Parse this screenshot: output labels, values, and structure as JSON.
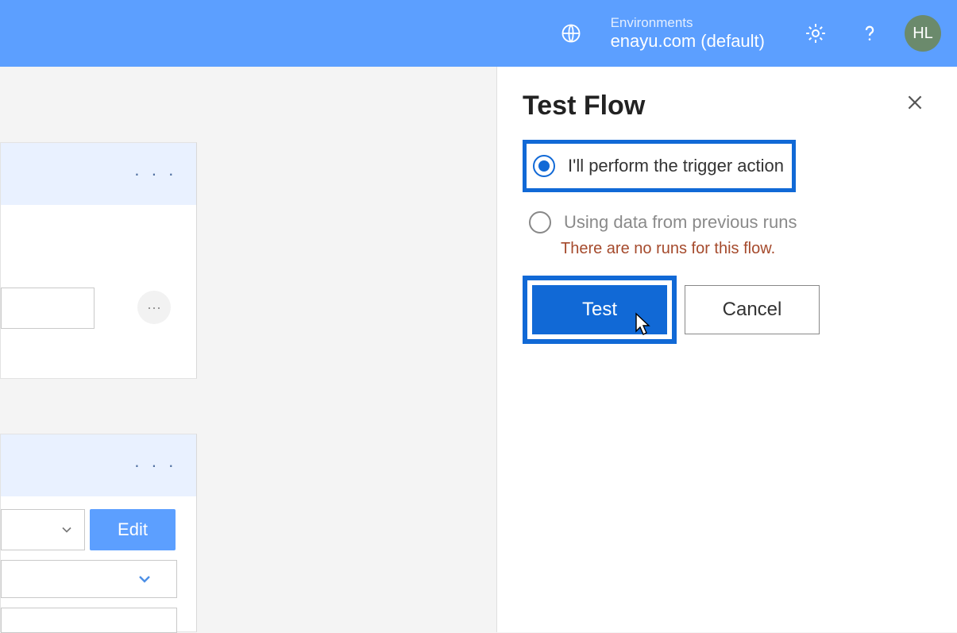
{
  "header": {
    "env_label": "Environments",
    "env_name": "enayu.com (default)",
    "avatar_initials": "HL"
  },
  "left": {
    "card1_menu": "· · ·",
    "card1_more": "···",
    "card2_menu": "· · ·",
    "edit_label": "Edit"
  },
  "panel": {
    "title": "Test Flow",
    "option1": "I'll perform the trigger action",
    "option2": "Using data from previous runs",
    "warning": "There are no runs for this flow.",
    "test_label": "Test",
    "cancel_label": "Cancel"
  }
}
